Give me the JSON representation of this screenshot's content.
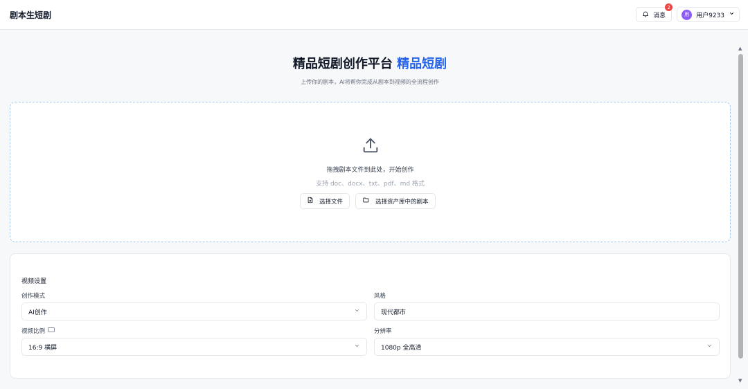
{
  "header": {
    "brand": "剧本生短剧",
    "messages_label": "消息",
    "messages_count": "2",
    "avatar_text": "用",
    "username": "用户9233"
  },
  "hero": {
    "title": "精品短剧创作平台",
    "title_accent": "精品短剧",
    "subtitle": "上传你的剧本，AI将帮你完成从剧本到视频的全流程创作"
  },
  "upload": {
    "main_text": "拖拽剧本文件到此处，开始创作",
    "hint_text": "支持 doc、docx、txt、pdf、md 格式",
    "choose_file_label": "选择文件",
    "choose_asset_label": "选择资产库中的剧本"
  },
  "settings": {
    "section_title": "视频设置",
    "mode_label": "创作模式",
    "mode_value": "AI创作",
    "style_label": "风格",
    "style_value": "现代都市",
    "ratio_label": "视频比例",
    "ratio_value": "16:9 横屏",
    "resolution_label": "分辨率",
    "resolution_value": "1080p 全高清"
  },
  "colors": {
    "accent": "#2563eb",
    "badge": "#ef4444",
    "avatar": "#8b5cf6"
  }
}
